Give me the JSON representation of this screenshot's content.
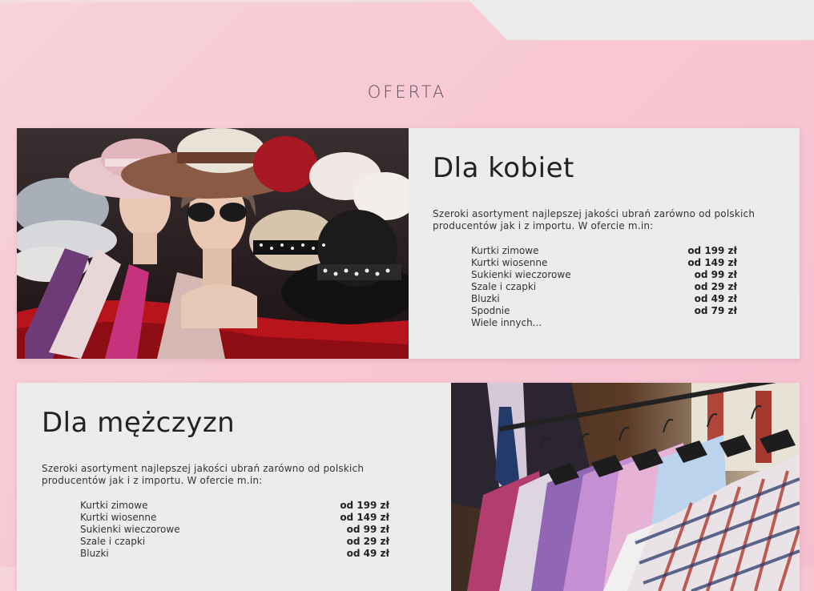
{
  "section": {
    "title": "OFERTA"
  },
  "women": {
    "heading": "Dla kobiet",
    "description": "Szeroki asortyment najlepszej jakości ubrań zarówno od polskich producentów jak i z importu. W ofercie m.in:",
    "items": [
      {
        "name": "Kurtki zimowe",
        "price": "od 199 zł"
      },
      {
        "name": "Kurtki wiosenne",
        "price": "od 149 zł"
      },
      {
        "name": "Sukienki wieczorowe",
        "price": "od 99 zł"
      },
      {
        "name": "Szale i czapki",
        "price": "od 29 zł"
      },
      {
        "name": "Bluzki",
        "price": "od 49 zł"
      },
      {
        "name": "Spodnie",
        "price": "od 79 zł"
      },
      {
        "name": "Wiele innych...",
        "price": ""
      }
    ]
  },
  "men": {
    "heading": "Dla mężczyzn",
    "description": "Szeroki asortyment najlepszej jakości ubrań zarówno od polskich producentów jak i z importu. W ofercie m.in:",
    "items": [
      {
        "name": "Kurtki zimowe",
        "price": "od 199 zł"
      },
      {
        "name": "Kurtki wiosenne",
        "price": "od 149 zł"
      },
      {
        "name": "Sukienki wieczorowe",
        "price": "od 99 zł"
      },
      {
        "name": "Szale i czapki",
        "price": "od 29 zł"
      },
      {
        "name": "Bluzki",
        "price": "od 49 zł"
      }
    ]
  },
  "colors": {
    "background": "#f7c8d4",
    "card": "#ececec",
    "header_bar": "#ececec"
  }
}
